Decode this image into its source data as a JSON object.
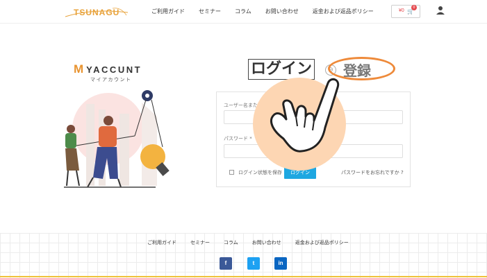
{
  "header": {
    "logo": "TSUNAGU",
    "nav": [
      "ご利用ガイド",
      "セミナー",
      "コラム",
      "お問い合わせ",
      "返金および返品ポリシー"
    ],
    "cart_price": "¥0",
    "cart_count": "0"
  },
  "account": {
    "title_initial": "M",
    "title_rest": "YACCUNT",
    "subtitle": "マイアカウント"
  },
  "login": {
    "title": "ログイン",
    "register": "登録",
    "username_label": "ユーザー名また",
    "password_label": "パスワード *",
    "remember_label": "ログイン状態を保存",
    "login_button": "ログイン",
    "forgot_link": "パスワードをお忘れですか ?"
  },
  "footer": {
    "nav": [
      "ご利用ガイド",
      "セミナー",
      "コラム",
      "お問い合わせ",
      "返金および返品ポリシー"
    ],
    "social": [
      "f",
      "t",
      "in"
    ]
  },
  "colors": {
    "accent_orange": "#ee8a3a",
    "button_blue": "#1ea7e1",
    "hand_circle": "#fdd6b3",
    "footer_line": "#f0c23b"
  }
}
